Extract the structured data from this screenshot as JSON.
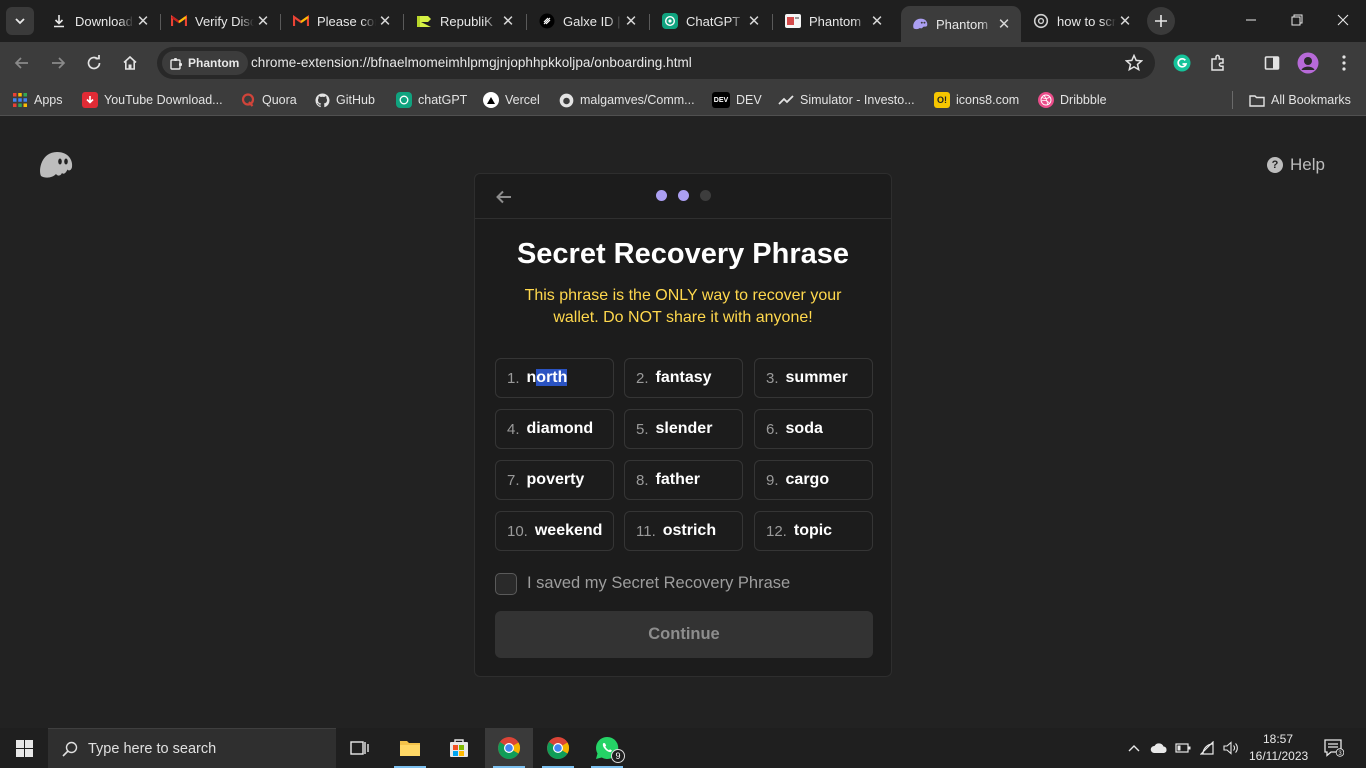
{
  "browser": {
    "tabs": [
      {
        "title": "Downloads",
        "favicon": "download-icon"
      },
      {
        "title": "Verify Discord",
        "favicon": "gmail-icon"
      },
      {
        "title": "Please confirm",
        "favicon": "gmail-icon"
      },
      {
        "title": "RepubliK",
        "favicon": "republik-icon"
      },
      {
        "title": "Galxe ID | Galxe",
        "favicon": "galxe-icon"
      },
      {
        "title": "ChatGPT",
        "favicon": "chatgpt-icon"
      },
      {
        "title": "Phantom",
        "favicon": "phantom-page-icon"
      },
      {
        "title": "Phantom",
        "favicon": "phantom-ghost-icon",
        "active": true
      },
      {
        "title": "how to screenshot",
        "favicon": "chrome-search-icon"
      }
    ],
    "site_chip": "Phantom",
    "url": "chrome-extension://bfnaelmomeimhlpmgjnjophhpkkoljpa/onboarding.html",
    "bookmarks": [
      {
        "label": "Apps",
        "icon": "apps-grid-icon"
      },
      {
        "label": "YouTube Download...",
        "icon": "youtube-download-icon"
      },
      {
        "label": "Quora",
        "icon": "quora-icon"
      },
      {
        "label": "GitHub",
        "icon": "github-icon"
      },
      {
        "label": "chatGPT",
        "icon": "chatgpt-icon"
      },
      {
        "label": "Vercel",
        "icon": "vercel-icon"
      },
      {
        "label": "malgamves/Comm...",
        "icon": "github-icon"
      },
      {
        "label": "DEV",
        "icon": "dev-icon"
      },
      {
        "label": "Simulator - Investo...",
        "icon": "investopedia-icon"
      },
      {
        "label": "icons8.com",
        "icon": "icons8-icon"
      },
      {
        "label": "Dribbble",
        "icon": "dribbble-icon"
      }
    ],
    "all_bookmarks": "All Bookmarks"
  },
  "page": {
    "help": "Help",
    "title": "Secret Recovery Phrase",
    "warning": "This phrase is the ONLY way to recover your wallet. Do NOT share it with anyone!",
    "progress": {
      "steps": 3,
      "current": 2
    },
    "words": [
      {
        "num": "1.",
        "word": "north",
        "selected_part": "orth"
      },
      {
        "num": "2.",
        "word": "fantasy"
      },
      {
        "num": "3.",
        "word": "summer"
      },
      {
        "num": "4.",
        "word": "diamond"
      },
      {
        "num": "5.",
        "word": "slender"
      },
      {
        "num": "6.",
        "word": "soda"
      },
      {
        "num": "7.",
        "word": "poverty"
      },
      {
        "num": "8.",
        "word": "father"
      },
      {
        "num": "9.",
        "word": "cargo"
      },
      {
        "num": "10.",
        "word": "weekend"
      },
      {
        "num": "11.",
        "word": "ostrich"
      },
      {
        "num": "12.",
        "word": "topic"
      }
    ],
    "checkbox_label": "I saved my Secret Recovery Phrase",
    "checkbox_checked": false,
    "continue": "Continue",
    "colors": {
      "accent": "#ab9ff2",
      "warning": "#ffd84d",
      "background": "#222222",
      "card": "#1c1c1c"
    }
  },
  "taskbar": {
    "search_placeholder": "Type here to search",
    "whatsapp_badge": "9",
    "time": "18:57",
    "date": "16/11/2023"
  }
}
